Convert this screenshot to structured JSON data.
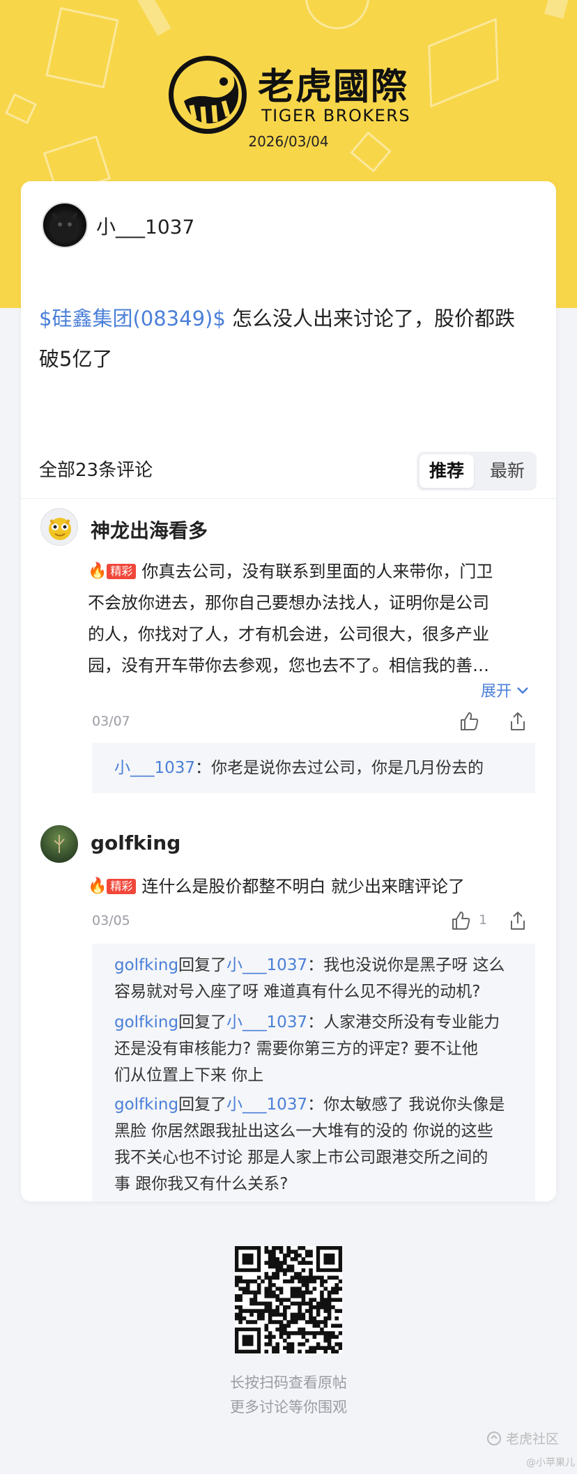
{
  "header": {
    "brand_cn": "老虎國際",
    "brand_en": "TIGER BROKERS",
    "date": "2026/03/04",
    "colors": {
      "background": "#f7d64a",
      "logo": "#111111"
    }
  },
  "post": {
    "author": "小___1037",
    "stock_tag": "$硅鑫集团(08349)$",
    "text": " 怎么没人出来讨论了，股价都跌破5亿了"
  },
  "comments_section": {
    "count_label": "全部23条评论",
    "tabs": [
      {
        "label": "推荐",
        "active": true
      },
      {
        "label": "最新",
        "active": false
      }
    ]
  },
  "comments": [
    {
      "author": "神龙出海看多",
      "badge": "精彩",
      "text_lines": [
        "你真去公司，没有联系到里面的人来带你，门卫",
        "不会放你进去，那你自己要想办法找人，证明你是公司",
        "的人，你找对了人，才有机会进，公司很大，很多产业",
        "园，没有开车带你去参观，您也去不了。相信我的善…"
      ],
      "expand_label": "展开",
      "date": "03/07",
      "likes": "",
      "replies": [
        {
          "name": "小___1037",
          "text": "：你老是说你去过公司，你是几月份去的"
        }
      ]
    },
    {
      "author": "golfking",
      "badge": "精彩",
      "text": "连什么是股价都整不明白 就少出来瞎评论了",
      "date": "03/05",
      "likes": "1",
      "replies": [
        {
          "name": "golfking",
          "verb": "回复了",
          "target": "小___1037",
          "lines": [
            "：我也没说你是黑子呀 这么",
            "容易就对号入座了呀 难道真有什么见不得光的动机?"
          ]
        },
        {
          "name": "golfking",
          "verb": "回复了",
          "target": "小___1037",
          "lines": [
            "：人家港交所没有专业能力",
            "还是没有审核能力? 需要你第三方的评定? 要不让他",
            "们从位置上下来 你上"
          ]
        },
        {
          "name": "golfking",
          "verb": "回复了",
          "target": "小___1037",
          "lines": [
            "：你太敏感了 我说你头像是",
            "黑脸 你居然跟我扯出这么一大堆有的没的 你说的这些",
            "我不关心也不讨论 那是人家上市公司跟港交所之间的",
            "事 跟你我又有什么关系?"
          ]
        }
      ]
    }
  ],
  "footer": {
    "qr_caption_1": "长按扫码查看原帖",
    "qr_caption_2": "更多讨论等你围观",
    "watermark": "老虎社区",
    "watermark_author": "@小苹果儿"
  },
  "icons": {
    "logo": "tiger-logo-icon",
    "like": "thumbs-up-icon",
    "share": "share-icon",
    "expand": "chevron-down-icon",
    "fire": "fire-icon"
  }
}
